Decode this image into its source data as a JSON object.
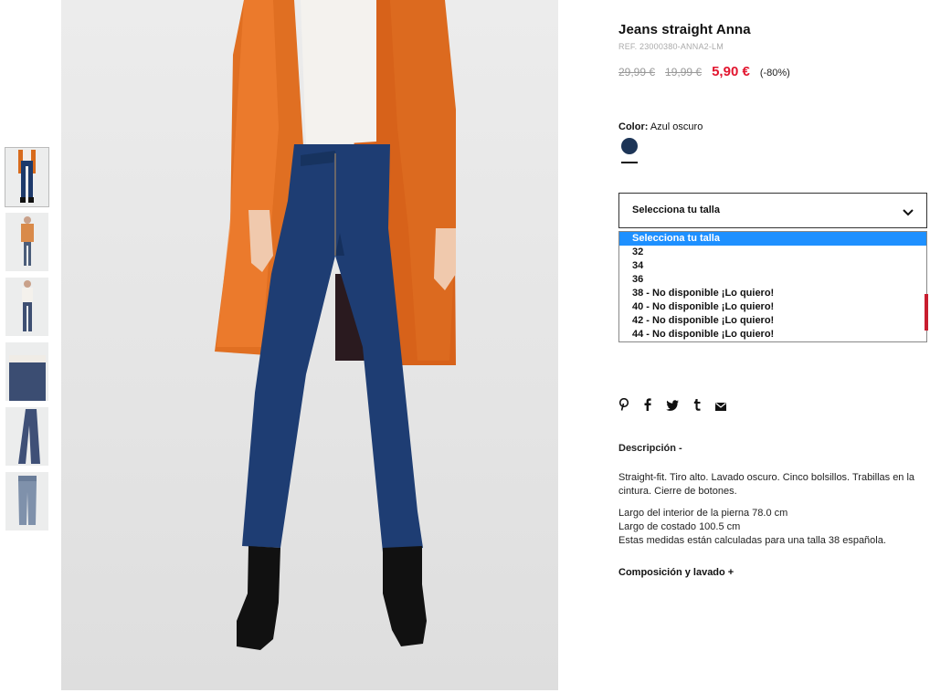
{
  "product": {
    "title": "Jeans straight Anna",
    "ref": "REF. 23000380-ANNA2-LM",
    "price_old_1": "29,99 €",
    "price_old_2": "19,99 €",
    "price_sale": "5,90 €",
    "discount": "(-80%)",
    "accent_color": "#e2162f"
  },
  "color": {
    "label": "Color:",
    "value": "Azul oscuro",
    "swatch": "#1d3557"
  },
  "size_select": {
    "selected": "Selecciona tu talla",
    "options": [
      "Selecciona tu talla",
      "32",
      "34",
      "36",
      "38 - No disponible ¡Lo quiero!",
      "40 - No disponible ¡Lo quiero!",
      "42 - No disponible ¡Lo quiero!",
      "44 - No disponible ¡Lo quiero!"
    ]
  },
  "share_icons": [
    "pinterest-icon",
    "facebook-icon",
    "twitter-icon",
    "tumblr-icon",
    "mail-icon"
  ],
  "description": {
    "heading": "Descripción -",
    "text": "Straight-fit. Tiro alto. Lavado oscuro. Cinco bolsillos. Trabillas en la cintura. Cierre de botones.",
    "measure_1": "Largo del interior de la pierna 78.0 cm",
    "measure_2": "Largo de costado 100.5 cm",
    "measure_3": "Estas medidas están calculadas para una talla 38 española."
  },
  "composition": {
    "heading": "Composición y lavado +"
  }
}
